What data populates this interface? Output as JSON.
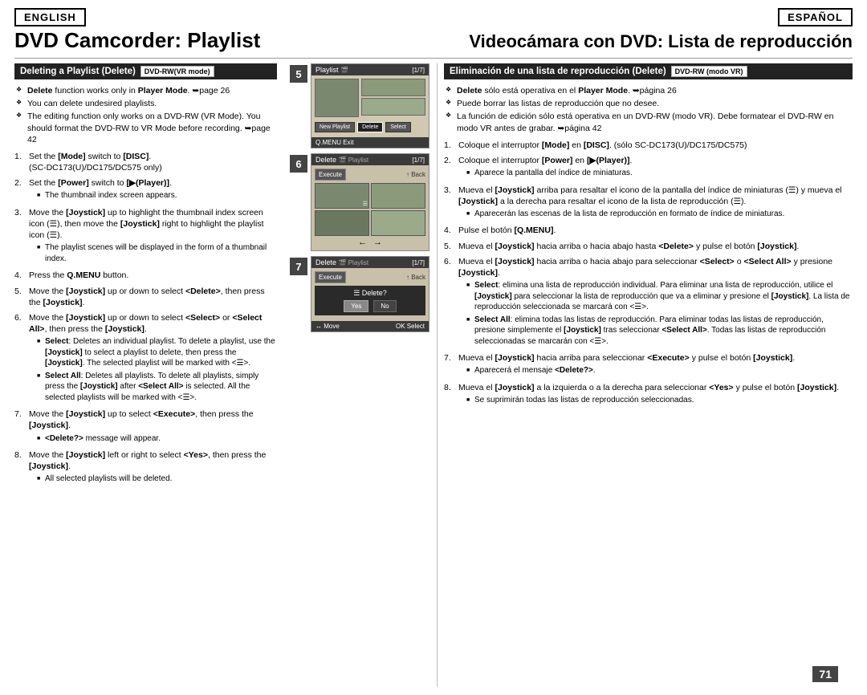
{
  "header": {
    "lang_en": "ENGLISH",
    "lang_es": "ESPAÑOL",
    "title_en": "DVD Camcorder: Playlist",
    "title_es": "Videocámara con DVD: Lista de reproducción"
  },
  "section_en": {
    "heading": "Deleting a Playlist (Delete)",
    "dvd_badge": "DVD-RW(VR mode)",
    "bullets": [
      "Delete function works only in Player Mode. ➥page 26",
      "You can delete undesired playlists.",
      "The editing function only works on a DVD-RW (VR Mode). You should format the DVD-RW to VR Mode before recording. ➥page 42"
    ],
    "steps": [
      {
        "num": "1.",
        "text": "Set the [Mode] switch to [DISC]. (SC-DC173(U)/DC175/DC575 only)"
      },
      {
        "num": "2.",
        "text": "Set the [Power] switch to [▶(Player)].",
        "sub": [
          "The thumbnail index screen appears."
        ]
      },
      {
        "num": "3.",
        "text": "Move the [Joystick] up to highlight the thumbnail index screen icon (☰), then move the [Joystick] right to highlight the playlist icon (☰).",
        "sub": [
          "The playlist scenes will be displayed in the form of a thumbnail index."
        ]
      },
      {
        "num": "4.",
        "text": "Press the Q.MENU button."
      },
      {
        "num": "5.",
        "text": "Move the [Joystick] up or down to select <Delete>, then press the [Joystick]."
      },
      {
        "num": "6.",
        "text": "Move the [Joystick] up or down to select <Select> or <Select All>, then press the [Joystick].",
        "sub": [
          "Select: Deletes an individual playlist. To delete a playlist, use the [Joystick] to select a playlist to delete, then press the [Joystick]. The selected playlist will be marked with <☰>.",
          "Select All: Deletes all playlists. To delete all playlists, simply press the [Joystick] after <Select All> is selected. All the selected playlists will be marked with <☰>."
        ]
      },
      {
        "num": "7.",
        "text": "Move the [Joystick] up to select <Execute>, then press the [Joystick].",
        "sub": [
          "<Delete?> message will appear."
        ]
      },
      {
        "num": "8.",
        "text": "Move the [Joystick] left or right to select <Yes>, then press the [Joystick].",
        "sub": [
          "All selected playlists will be deleted."
        ]
      }
    ]
  },
  "section_es": {
    "heading": "Eliminación de una lista de reproducción (Delete)",
    "dvd_badge": "DVD-RW (modo VR)",
    "bullets": [
      "Delete sólo está operativa en el Player Mode. ➥página 26",
      "Puede borrar las listas de reproducción que no desee.",
      "La función de edición sólo está operativa en un DVD-RW (modo VR). Debe formatear el DVD-RW en modo VR antes de grabar. ➥página 42"
    ],
    "steps": [
      {
        "num": "1.",
        "text": "Coloque el interruptor [Mode] en [DISC]. (sólo SC-DC173(U)/DC175/DC575)"
      },
      {
        "num": "2.",
        "text": "Coloque el interruptor [Power] en [▶(Player)].",
        "sub": [
          "Aparece la pantalla del índice de miniaturas."
        ]
      },
      {
        "num": "3.",
        "text": "Mueva el [Joystick] arriba para resaltar el icono de la pantalla del índice de miniaturas (☰) y mueva el [Joystick] a la derecha para resaltar el icono de la lista de reproducción (☰).",
        "sub": [
          "Aparecerán las escenas de la lista de reproducción en formato de índice de miniaturas."
        ]
      },
      {
        "num": "4.",
        "text": "Pulse el botón [Q.MENU]."
      },
      {
        "num": "5.",
        "text": "Mueva el [Joystick] hacia arriba o hacia abajo hasta <Delete> y pulse el botón [Joystick]."
      },
      {
        "num": "6.",
        "text": "Mueva el [Joystick] hacia arriba o hacia abajo para seleccionar <Select> o <Select All> y presione [Joystick].",
        "sub": [
          "Select: elimina una lista de reproducción individual. Para eliminar una lista de reproducción, utilice el [Joystick] para seleccionar la lista de reproducción que va a eliminar y presione el [Joystick]. La lista de reproducción seleccionada se marcará con <☰>.",
          "Select All: elimina todas las listas de reproducción. Para eliminar todas las listas de reproducción, presione simplemente el [Joystick] tras seleccionar <Select All>. Todas las listas de reproducción seleccionadas se marcarán con <☰>."
        ]
      },
      {
        "num": "7.",
        "text": "Mueva el [Joystick] hacia arriba para seleccionar <Execute> y pulse el botón [Joystick].",
        "sub": [
          "Aparecerá el mensaje <Delete?>."
        ]
      },
      {
        "num": "8.",
        "text": "Mueva el [Joystick] a la izquierda o a la derecha para seleccionar <Yes> y pulse el botón [Joystick].",
        "sub": [
          "Se suprimirán todas las listas de reproducción seleccionadas."
        ]
      }
    ]
  },
  "panels": {
    "panel5": {
      "number": "5",
      "header_left": "Playlist",
      "page": "[1/7]",
      "menu_items": [
        "New Playlist",
        "Delete",
        "Select"
      ],
      "footer": "Q.MENU Exit"
    },
    "panel6": {
      "number": "6",
      "header_left": "Delete",
      "header_right": "Playlist",
      "page": "[1/7]",
      "footer_right": "↑ Back"
    },
    "panel7": {
      "number": "7",
      "header_left": "Delete",
      "header_right": "Playlist",
      "page": "[1/7]",
      "execute": "Execute",
      "back": "↑ Back",
      "dialog": "☰ Delete?",
      "yes": "Yes",
      "no": "No",
      "footer_left": "↔ Move",
      "footer_right": "OK Select"
    }
  },
  "page_number": "71"
}
